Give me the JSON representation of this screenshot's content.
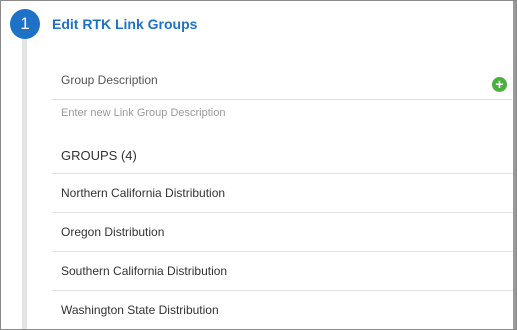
{
  "step": {
    "number": "1",
    "title": "Edit RTK Link Groups"
  },
  "description": {
    "label": "Group Description",
    "placeholder": "Enter new Link Group Description",
    "value": "",
    "add_symbol": "+"
  },
  "groups": {
    "heading": "GROUPS (4)",
    "items": [
      "Northern California Distribution",
      "Oregon Distribution",
      "Southern California Distribution",
      "Washington State Distribution"
    ]
  },
  "colors": {
    "accent": "#1d72c8",
    "add_button": "#4caf3f"
  }
}
